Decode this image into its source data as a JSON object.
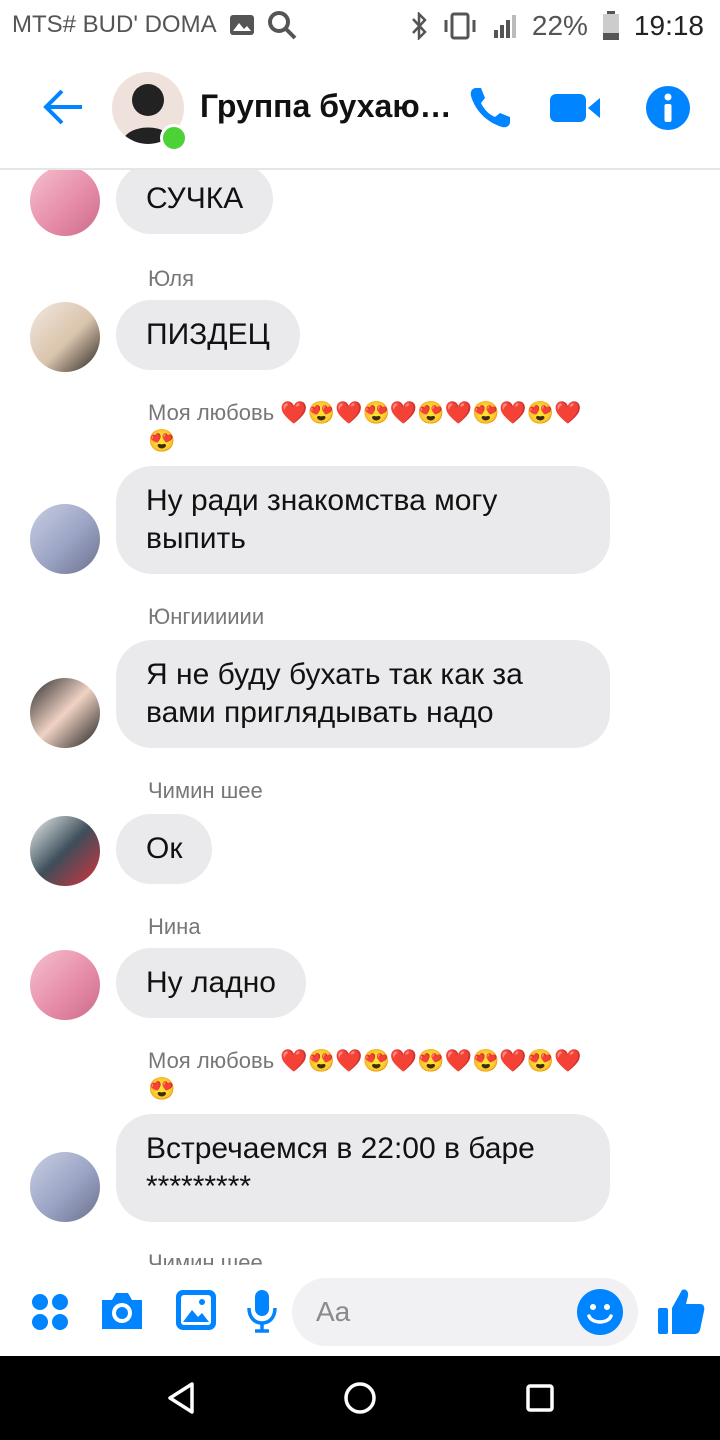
{
  "status": {
    "carrier": "MTS# BUD' DOMA",
    "battery": "22%",
    "time": "19:18"
  },
  "header": {
    "title": "Группа бухаю…"
  },
  "messages": [
    {
      "sender": "",
      "text": "СУЧКА"
    },
    {
      "sender": "Юля",
      "text": "ПИЗДЕЦ"
    },
    {
      "sender": "Моя любовь ❤️😍❤️😍❤️😍❤️😍❤️😍❤️",
      "sender_line2": "😍",
      "text": "Ну ради знакомства могу выпить"
    },
    {
      "sender": "Юнгииииии",
      "text": "Я не буду бухать так как за вами приглядывать надо"
    },
    {
      "sender": "Чимин шее",
      "text": "Ок"
    },
    {
      "sender": "Нина",
      "text": "Ну ладно"
    },
    {
      "sender": "Моя любовь ❤️😍❤️😍❤️😍❤️😍❤️😍❤️",
      "sender_line2": "😍",
      "text": "Встречаемся в 22:00 в баре *********"
    },
    {
      "sender": "Чимин шее",
      "text": ""
    }
  ],
  "composer": {
    "placeholder": "Aa"
  },
  "colors": {
    "accent": "#0084ff",
    "bubble": "#eaeaec",
    "online": "#4cd137"
  },
  "icons": [
    "back-arrow-icon",
    "phone-icon",
    "video-camera-icon",
    "info-icon",
    "menu-dots-icon",
    "camera-icon",
    "image-icon",
    "microphone-icon",
    "emoji-icon",
    "thumbs-up-icon",
    "bluetooth-icon",
    "vibrate-icon",
    "signal-icon",
    "battery-icon",
    "nav-back-icon",
    "nav-home-icon",
    "nav-recents-icon"
  ]
}
